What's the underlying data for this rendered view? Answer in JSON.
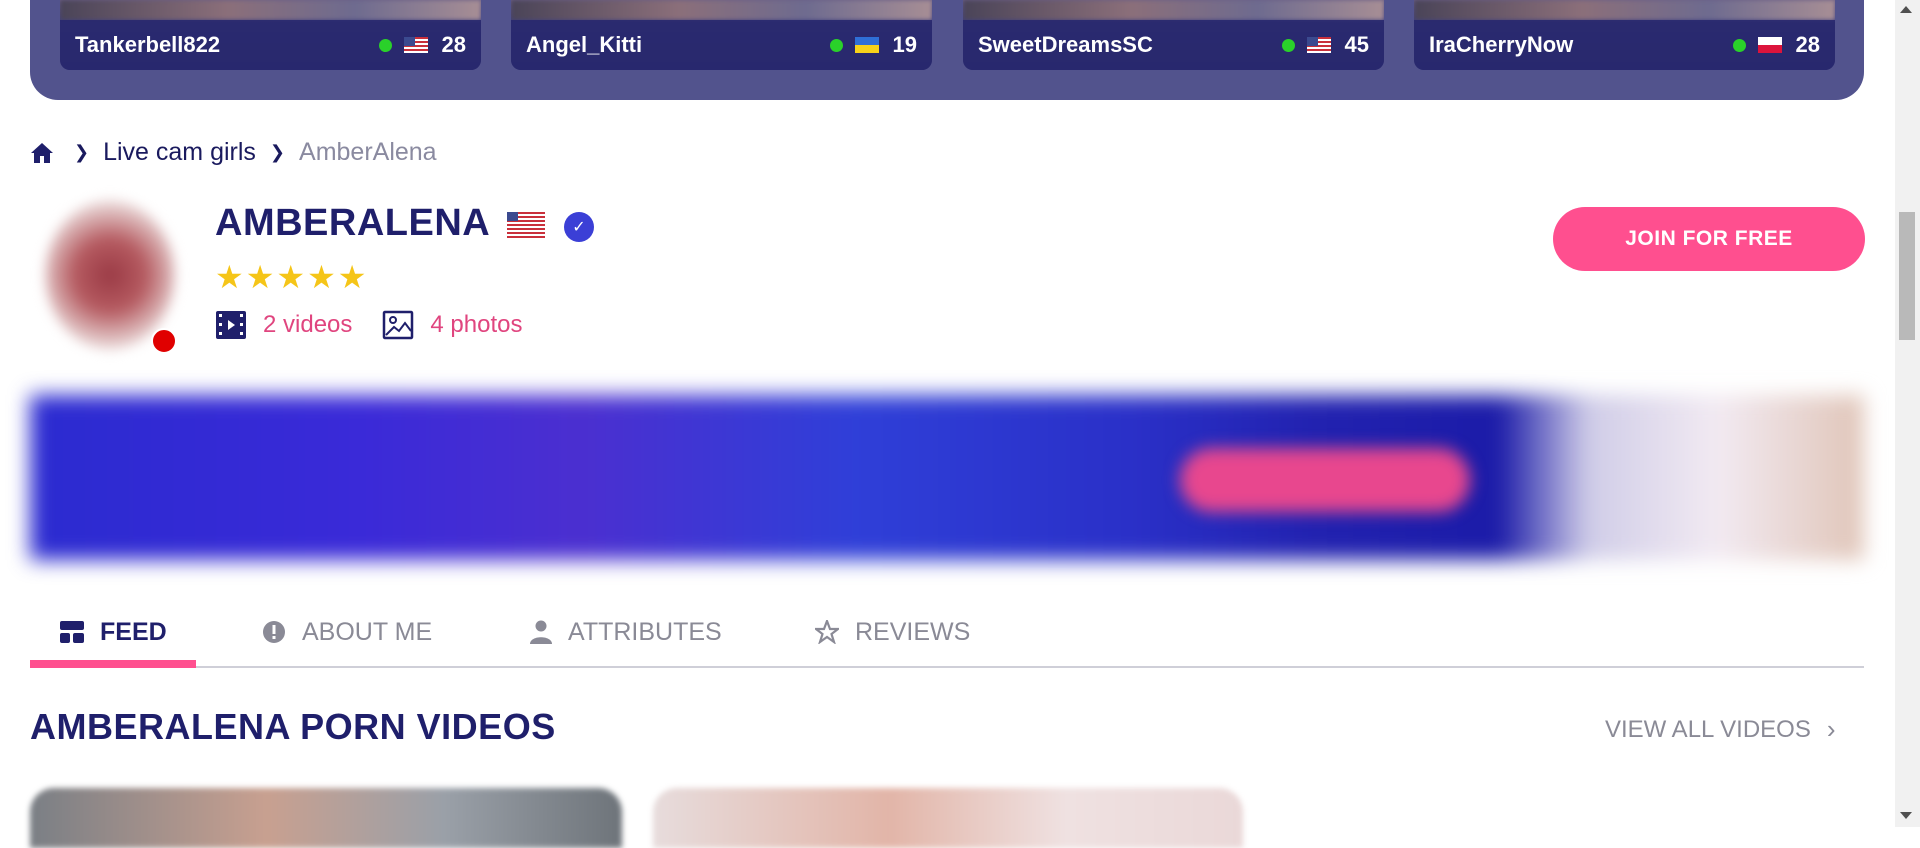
{
  "top_cards": [
    {
      "name": "Tankerbell822",
      "age": "28",
      "flag": "us"
    },
    {
      "name": "Angel_Kitti",
      "age": "19",
      "flag": "ua"
    },
    {
      "name": "SweetDreamsSC",
      "age": "45",
      "flag": "us"
    },
    {
      "name": "IraCherryNow",
      "age": "28",
      "flag": "pl"
    }
  ],
  "breadcrumb": {
    "items": [
      "Live cam girls",
      "AmberAlena"
    ]
  },
  "profile": {
    "name": "AMBERALENA",
    "flag": "us",
    "rating_stars": "★★★★★",
    "videos_label": "2 videos",
    "photos_label": "4 photos",
    "online": true
  },
  "join_button": "JOIN FOR FREE",
  "tabs": [
    {
      "label": "FEED",
      "icon": "feed-icon",
      "active": true
    },
    {
      "label": "ABOUT ME",
      "icon": "info-icon",
      "active": false
    },
    {
      "label": "ATTRIBUTES",
      "icon": "person-icon",
      "active": false
    },
    {
      "label": "REVIEWS",
      "icon": "star-icon",
      "active": false
    }
  ],
  "videos_section": {
    "title": "AMBERALENA PORN VIDEOS",
    "view_all": "VIEW ALL VIDEOS"
  },
  "colors": {
    "accent": "#ff4f8f",
    "navy": "#1f1f6b",
    "strip": "#52538d"
  }
}
